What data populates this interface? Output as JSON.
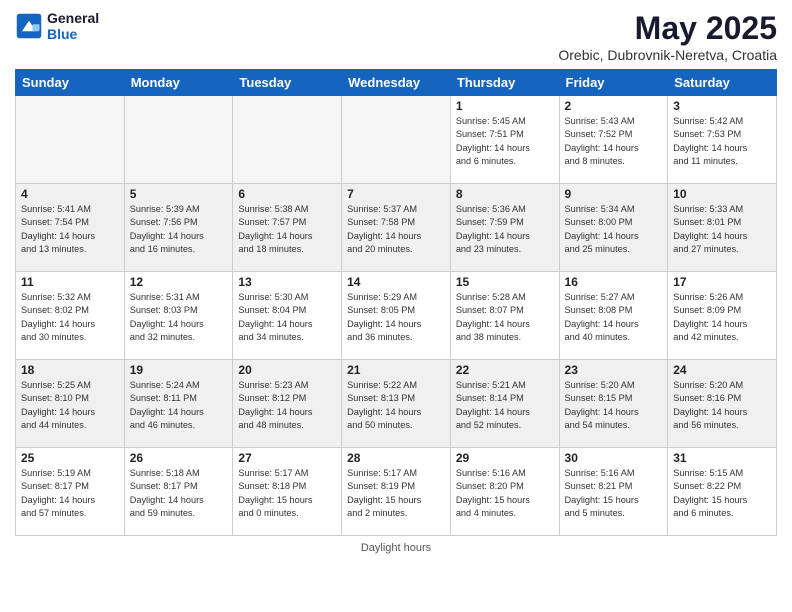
{
  "header": {
    "logo_general": "General",
    "logo_blue": "Blue",
    "month_title": "May 2025",
    "location": "Orebic, Dubrovnik-Neretva, Croatia"
  },
  "days_of_week": [
    "Sunday",
    "Monday",
    "Tuesday",
    "Wednesday",
    "Thursday",
    "Friday",
    "Saturday"
  ],
  "footer": {
    "daylight_label": "Daylight hours"
  },
  "weeks": [
    {
      "days": [
        {
          "num": "",
          "empty": true
        },
        {
          "num": "",
          "empty": true
        },
        {
          "num": "",
          "empty": true
        },
        {
          "num": "",
          "empty": true
        },
        {
          "num": "1",
          "info": "Sunrise: 5:45 AM\nSunset: 7:51 PM\nDaylight: 14 hours\nand 6 minutes."
        },
        {
          "num": "2",
          "info": "Sunrise: 5:43 AM\nSunset: 7:52 PM\nDaylight: 14 hours\nand 8 minutes."
        },
        {
          "num": "3",
          "info": "Sunrise: 5:42 AM\nSunset: 7:53 PM\nDaylight: 14 hours\nand 11 minutes."
        }
      ]
    },
    {
      "days": [
        {
          "num": "4",
          "info": "Sunrise: 5:41 AM\nSunset: 7:54 PM\nDaylight: 14 hours\nand 13 minutes."
        },
        {
          "num": "5",
          "info": "Sunrise: 5:39 AM\nSunset: 7:56 PM\nDaylight: 14 hours\nand 16 minutes."
        },
        {
          "num": "6",
          "info": "Sunrise: 5:38 AM\nSunset: 7:57 PM\nDaylight: 14 hours\nand 18 minutes."
        },
        {
          "num": "7",
          "info": "Sunrise: 5:37 AM\nSunset: 7:58 PM\nDaylight: 14 hours\nand 20 minutes."
        },
        {
          "num": "8",
          "info": "Sunrise: 5:36 AM\nSunset: 7:59 PM\nDaylight: 14 hours\nand 23 minutes."
        },
        {
          "num": "9",
          "info": "Sunrise: 5:34 AM\nSunset: 8:00 PM\nDaylight: 14 hours\nand 25 minutes."
        },
        {
          "num": "10",
          "info": "Sunrise: 5:33 AM\nSunset: 8:01 PM\nDaylight: 14 hours\nand 27 minutes."
        }
      ]
    },
    {
      "days": [
        {
          "num": "11",
          "info": "Sunrise: 5:32 AM\nSunset: 8:02 PM\nDaylight: 14 hours\nand 30 minutes."
        },
        {
          "num": "12",
          "info": "Sunrise: 5:31 AM\nSunset: 8:03 PM\nDaylight: 14 hours\nand 32 minutes."
        },
        {
          "num": "13",
          "info": "Sunrise: 5:30 AM\nSunset: 8:04 PM\nDaylight: 14 hours\nand 34 minutes."
        },
        {
          "num": "14",
          "info": "Sunrise: 5:29 AM\nSunset: 8:05 PM\nDaylight: 14 hours\nand 36 minutes."
        },
        {
          "num": "15",
          "info": "Sunrise: 5:28 AM\nSunset: 8:07 PM\nDaylight: 14 hours\nand 38 minutes."
        },
        {
          "num": "16",
          "info": "Sunrise: 5:27 AM\nSunset: 8:08 PM\nDaylight: 14 hours\nand 40 minutes."
        },
        {
          "num": "17",
          "info": "Sunrise: 5:26 AM\nSunset: 8:09 PM\nDaylight: 14 hours\nand 42 minutes."
        }
      ]
    },
    {
      "days": [
        {
          "num": "18",
          "info": "Sunrise: 5:25 AM\nSunset: 8:10 PM\nDaylight: 14 hours\nand 44 minutes."
        },
        {
          "num": "19",
          "info": "Sunrise: 5:24 AM\nSunset: 8:11 PM\nDaylight: 14 hours\nand 46 minutes."
        },
        {
          "num": "20",
          "info": "Sunrise: 5:23 AM\nSunset: 8:12 PM\nDaylight: 14 hours\nand 48 minutes."
        },
        {
          "num": "21",
          "info": "Sunrise: 5:22 AM\nSunset: 8:13 PM\nDaylight: 14 hours\nand 50 minutes."
        },
        {
          "num": "22",
          "info": "Sunrise: 5:21 AM\nSunset: 8:14 PM\nDaylight: 14 hours\nand 52 minutes."
        },
        {
          "num": "23",
          "info": "Sunrise: 5:20 AM\nSunset: 8:15 PM\nDaylight: 14 hours\nand 54 minutes."
        },
        {
          "num": "24",
          "info": "Sunrise: 5:20 AM\nSunset: 8:16 PM\nDaylight: 14 hours\nand 56 minutes."
        }
      ]
    },
    {
      "days": [
        {
          "num": "25",
          "info": "Sunrise: 5:19 AM\nSunset: 8:17 PM\nDaylight: 14 hours\nand 57 minutes."
        },
        {
          "num": "26",
          "info": "Sunrise: 5:18 AM\nSunset: 8:17 PM\nDaylight: 14 hours\nand 59 minutes."
        },
        {
          "num": "27",
          "info": "Sunrise: 5:17 AM\nSunset: 8:18 PM\nDaylight: 15 hours\nand 0 minutes."
        },
        {
          "num": "28",
          "info": "Sunrise: 5:17 AM\nSunset: 8:19 PM\nDaylight: 15 hours\nand 2 minutes."
        },
        {
          "num": "29",
          "info": "Sunrise: 5:16 AM\nSunset: 8:20 PM\nDaylight: 15 hours\nand 4 minutes."
        },
        {
          "num": "30",
          "info": "Sunrise: 5:16 AM\nSunset: 8:21 PM\nDaylight: 15 hours\nand 5 minutes."
        },
        {
          "num": "31",
          "info": "Sunrise: 5:15 AM\nSunset: 8:22 PM\nDaylight: 15 hours\nand 6 minutes."
        }
      ]
    }
  ]
}
